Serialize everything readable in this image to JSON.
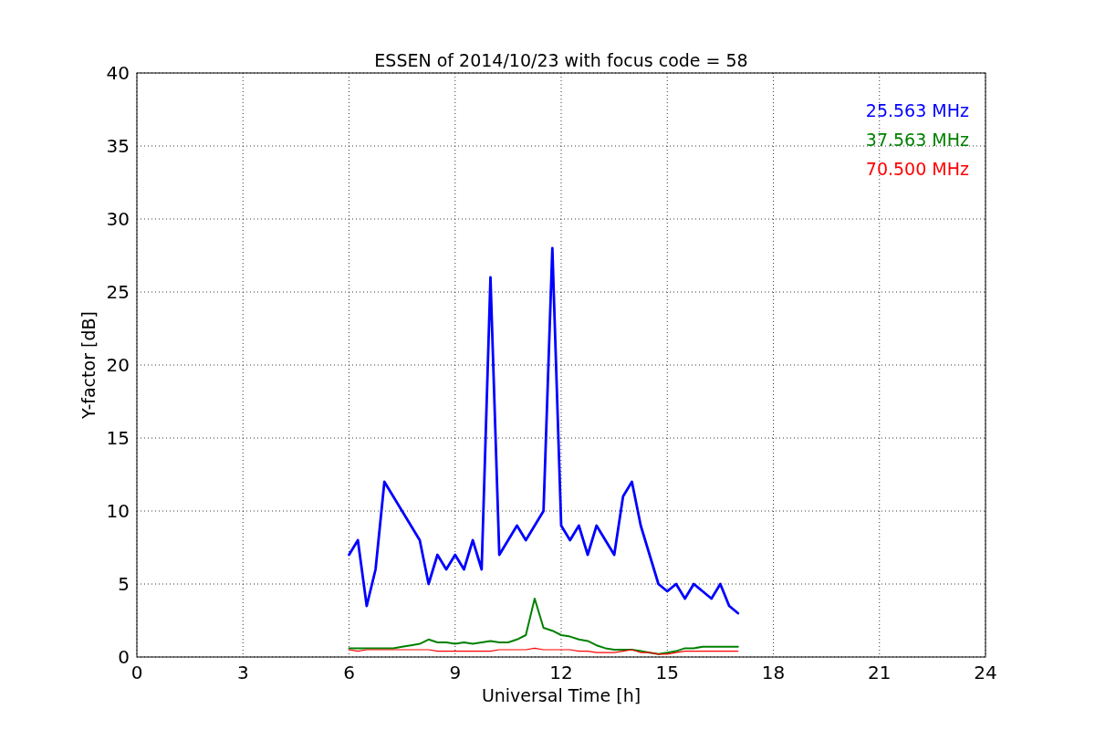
{
  "figure": {
    "chart_data": {
      "type": "line",
      "title": "ESSEN of 2014/10/23 with focus code = 58",
      "xlabel": "Universal Time [h]",
      "ylabel": "Y-factor [dB]",
      "x": [
        6,
        6.25,
        6.5,
        6.75,
        7,
        7.25,
        7.5,
        7.75,
        8,
        8.25,
        8.5,
        8.75,
        9,
        9.25,
        9.5,
        9.75,
        10,
        10.25,
        10.5,
        10.75,
        11,
        11.25,
        11.5,
        11.75,
        12,
        12.25,
        12.5,
        12.75,
        13,
        13.25,
        13.5,
        13.75,
        14,
        14.25,
        14.5,
        14.75,
        15,
        15.25,
        15.5,
        15.75,
        16,
        16.25,
        16.5,
        16.75,
        17
      ],
      "series": [
        {
          "name": "25.563 MHz",
          "color": "#0000ff",
          "values": [
            7,
            8,
            3.5,
            6,
            12,
            11,
            10,
            9,
            8,
            5,
            7,
            6,
            7,
            6,
            8,
            6,
            26,
            7,
            8,
            9,
            8,
            9,
            10,
            28,
            9,
            8,
            9,
            7,
            9,
            8,
            7,
            11,
            12,
            9,
            7,
            5,
            4.5,
            5,
            4,
            5,
            4.5,
            4,
            5,
            3.5,
            3
          ]
        },
        {
          "name": "37.563 MHz",
          "color": "#008000",
          "values": [
            0.6,
            0.6,
            0.6,
            0.6,
            0.6,
            0.6,
            0.7,
            0.8,
            0.9,
            1.2,
            1,
            1,
            0.9,
            1,
            0.9,
            1,
            1.1,
            1,
            1,
            1.2,
            1.5,
            4,
            2,
            1.8,
            1.5,
            1.4,
            1.2,
            1.1,
            0.8,
            0.6,
            0.5,
            0.5,
            0.5,
            0.4,
            0.3,
            0.2,
            0.3,
            0.4,
            0.6,
            0.6,
            0.7,
            0.7,
            0.7,
            0.7,
            0.7
          ]
        },
        {
          "name": "70.500 MHz",
          "color": "#ff0000",
          "values": [
            0.5,
            0.4,
            0.5,
            0.5,
            0.5,
            0.5,
            0.5,
            0.5,
            0.5,
            0.5,
            0.4,
            0.4,
            0.4,
            0.4,
            0.4,
            0.4,
            0.4,
            0.5,
            0.5,
            0.5,
            0.5,
            0.6,
            0.5,
            0.5,
            0.5,
            0.5,
            0.4,
            0.4,
            0.3,
            0.3,
            0.3,
            0.4,
            0.5,
            0.3,
            0.3,
            0.2,
            0.2,
            0.3,
            0.4,
            0.4,
            0.4,
            0.4,
            0.4,
            0.4,
            0.4
          ]
        }
      ],
      "grid": true,
      "xlim": [
        0,
        24
      ],
      "ylim": [
        0,
        40
      ],
      "xticks": [
        0,
        3,
        6,
        9,
        12,
        15,
        18,
        21,
        24
      ],
      "yticks": [
        0,
        5,
        10,
        15,
        20,
        25,
        30,
        35,
        40
      ]
    }
  }
}
